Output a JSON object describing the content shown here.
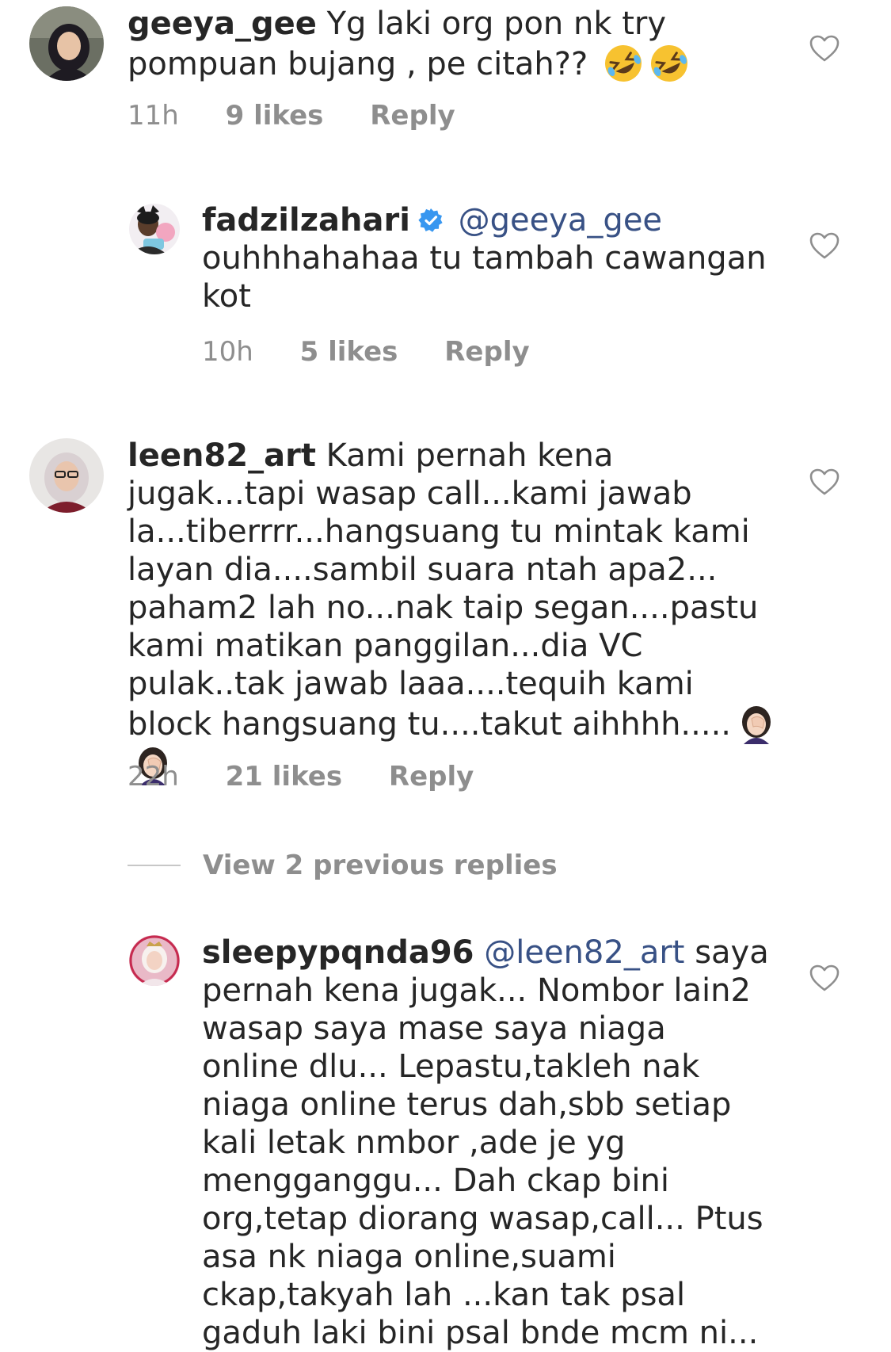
{
  "comments": [
    {
      "username": "geeya_gee",
      "text": "Yg laki org pon nk try pompuan bujang , pe citah??",
      "emoji": [
        "rolling-on-floor-laughing-emoji",
        "rolling-on-floor-laughing-emoji"
      ],
      "time": "11h",
      "likes": "9 likes",
      "reply": "Reply"
    },
    {
      "username": "fadzilzahari",
      "verified": true,
      "mention": "@geeya_gee",
      "text": "ouhhhahahaa tu tambah cawangan kot",
      "time": "10h",
      "likes": "5 likes",
      "reply": "Reply"
    },
    {
      "username": "leen82_art",
      "text": "Kami pernah kena jugak...tapi wasap call...kami jawab la...tiberrrr...hangsuang tu mintak kami layan dia....sambil suara ntah apa2... paham2 lah no...nak taip segan....pastu kami matikan panggilan...dia VC pulak..tak jawab laaa....tequih kami block hangsuang tu....takut aihhhh.....",
      "emoji": [
        "woman-facepalming-emoji",
        "woman-facepalming-emoji"
      ],
      "time": "22h",
      "likes": "21 likes",
      "reply": "Reply"
    },
    {
      "username": "sleepypqnda96",
      "mention": "@leen82_art",
      "text": "saya pernah kena jugak... Nombor lain2 wasap saya mase saya niaga online dlu... Lepastu,takleh nak niaga online terus dah,sbb setiap kali letak nmbor ,ade je yg mengganggu... Dah ckap bini org,tetap diorang wasap,call... Ptus asa nk niaga online,suami ckap,takyah lah ...kan tak psal gaduh laki bini psal bnde mcm ni..."
    }
  ],
  "view_previous_replies": "View 2 previous replies",
  "icons": {
    "like": "heart-outline-icon",
    "verified": "verified-badge-icon"
  },
  "colors": {
    "text": "#262626",
    "secondary": "#8e8e8e",
    "mention": "#385185",
    "verified": "#3897f0"
  }
}
